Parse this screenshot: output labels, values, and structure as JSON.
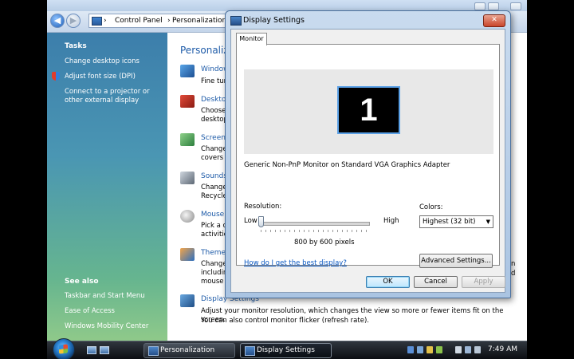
{
  "control_panel": {
    "breadcrumb": [
      "Control Panel",
      "Personalization"
    ],
    "tasks_heading": "Tasks",
    "tasks": [
      "Change desktop icons",
      "Adjust font size (DPI)",
      "Connect to a projector or other external display"
    ],
    "see_also_heading": "See also",
    "see_also": [
      "Taskbar and Start Menu",
      "Ease of Access",
      "Windows Mobility Center"
    ],
    "title": "Personalize",
    "items": [
      {
        "title": "Window",
        "desc": "Fine tun"
      },
      {
        "title": "Desktop",
        "desc": "Choose\ndesktop"
      },
      {
        "title": "Screen",
        "desc": "Change\ncovers y"
      },
      {
        "title": "Sounds",
        "desc": "Change\nRecycle"
      },
      {
        "title": "Mouse",
        "desc": "Pick a c\nactivitie"
      },
      {
        "title": "Theme",
        "desc": "Change\nincludin\nmouse"
      }
    ],
    "display_settings": {
      "title": "Display Settings",
      "desc_1": "Adjust your monitor resolution, which changes the view so more or fewer items fit on the screen.",
      "desc_2": "You can also control monitor flicker (refresh rate)."
    },
    "overflow_letters": [
      "n",
      "d"
    ]
  },
  "dialog": {
    "title": "Display Settings",
    "close_label": "✕",
    "tab": "Monitor",
    "monitor_number": "1",
    "monitor_name": "Generic Non-PnP Monitor on Standard VGA Graphics Adapter",
    "resolution_label": "Resolution:",
    "low": "Low",
    "high": "High",
    "resolution_value": "800 by 600 pixels",
    "resolution_slider_fraction": 0,
    "colors_label": "Colors:",
    "colors_value": "Highest (32 bit)",
    "help_link": "How do I get the best display?",
    "advanced_button": "Advanced Settings...",
    "ok_button": "OK",
    "cancel_button": "Cancel",
    "apply_button": "Apply"
  },
  "taskbar": {
    "tasks": [
      "Personalization",
      "Display Settings"
    ],
    "clock": "7:49 AM"
  },
  "colors": {
    "link_blue": "#1e5ba8",
    "sidebar_top": "#3c7eab",
    "sidebar_bottom": "#8fc98a",
    "close_red": "#c9452a"
  }
}
